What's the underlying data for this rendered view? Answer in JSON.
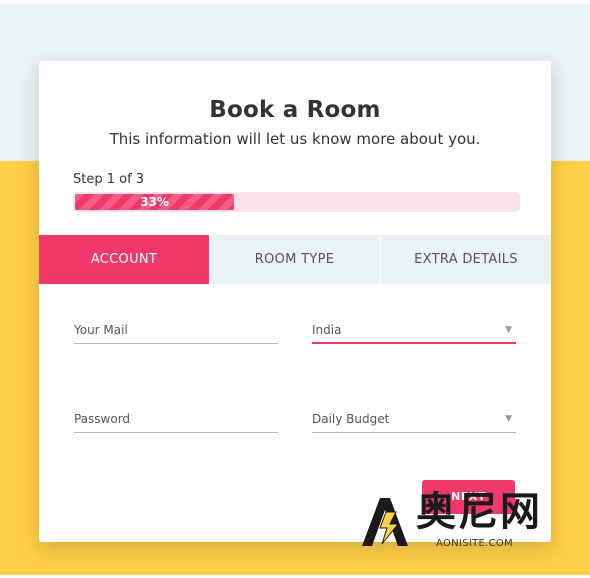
{
  "form": {
    "title": "Book a Room",
    "subtitle": "This information will let us know more about you.",
    "step_text": "Step 1 of 3",
    "progress_label": "33%",
    "progress_value": 0.365
  },
  "tabs": [
    {
      "label": "ACCOUNT",
      "active": true
    },
    {
      "label": "ROOM TYPE",
      "active": false
    },
    {
      "label": "EXTRA DETAILS",
      "active": false
    }
  ],
  "fields": {
    "mail_placeholder": "Your Mail",
    "country_value": "India",
    "password_placeholder": "Password",
    "budget_value": "Daily Budget"
  },
  "buttons": {
    "next_label": "NEXT"
  },
  "watermark": {
    "text": "奥尼网",
    "url": "AONISITE.COM"
  },
  "colors": {
    "accent": "#f0386b",
    "top_background": "#eaf2f5",
    "bottom_background": "#ffcf47",
    "card": "#ffffff"
  },
  "icons": {
    "dropdown": "caret-down-icon",
    "watermark_logo": "bolt-logo-icon"
  }
}
